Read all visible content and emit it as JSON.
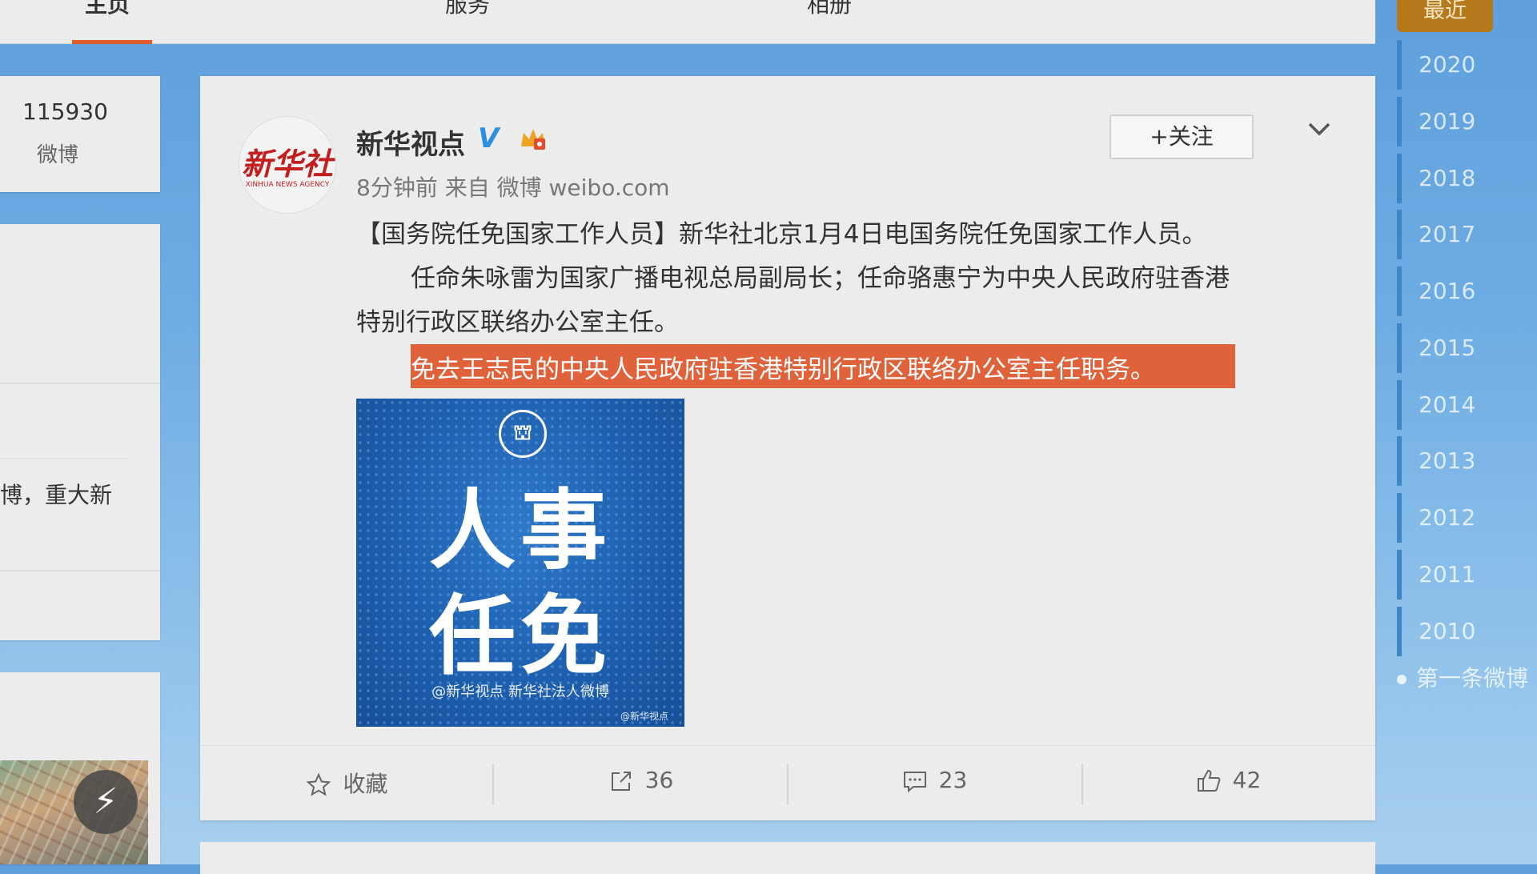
{
  "topnav": {
    "tabs": [
      "主页",
      "服务",
      "相册"
    ]
  },
  "left": {
    "stat_value": "115930",
    "stat_label": "微博",
    "snippet": "博，重大新",
    "quick_icon": "lightning-icon"
  },
  "post": {
    "author": "新华视点",
    "verified_mark": "V",
    "avatar_text": "新华社",
    "avatar_subtext": "XINHUA NEWS AGENCY",
    "meta": "8分钟前 来自 微博 weibo.com",
    "follow_label": "+关注",
    "paragraph1": "【国务院任免国家工作人员】新华社北京1月4日电国务院任免国家工作人员。",
    "paragraph2_line1": "任命朱咏雷为国家广播电视总局副局长；任命骆惠宁为中央人民政府驻香港",
    "paragraph2_line2": "特别行政区联络办公室主任。",
    "highlighted": "免去王志民的中央人民政府驻香港特别行政区联络办公室主任职务。",
    "image": {
      "title_line1": "人事",
      "title_line2": "任免",
      "credit": "@新华视点 新华社法人微博",
      "watermark": "@新华视点"
    },
    "actions": {
      "favorite_label": "收藏",
      "repost_count": "36",
      "comment_count": "23",
      "like_count": "42"
    }
  },
  "timeline": {
    "recent_label": "最近",
    "years": [
      "2020",
      "2019",
      "2018",
      "2017",
      "2016",
      "2015",
      "2014",
      "2013",
      "2012",
      "2011",
      "2010"
    ],
    "first_post_label": "第一条微博"
  },
  "colors": {
    "accent_orange": "#e05c28",
    "highlight": "#e0623a",
    "verified_blue": "#2a8fe0",
    "timeline_gold": "#b5791c"
  }
}
